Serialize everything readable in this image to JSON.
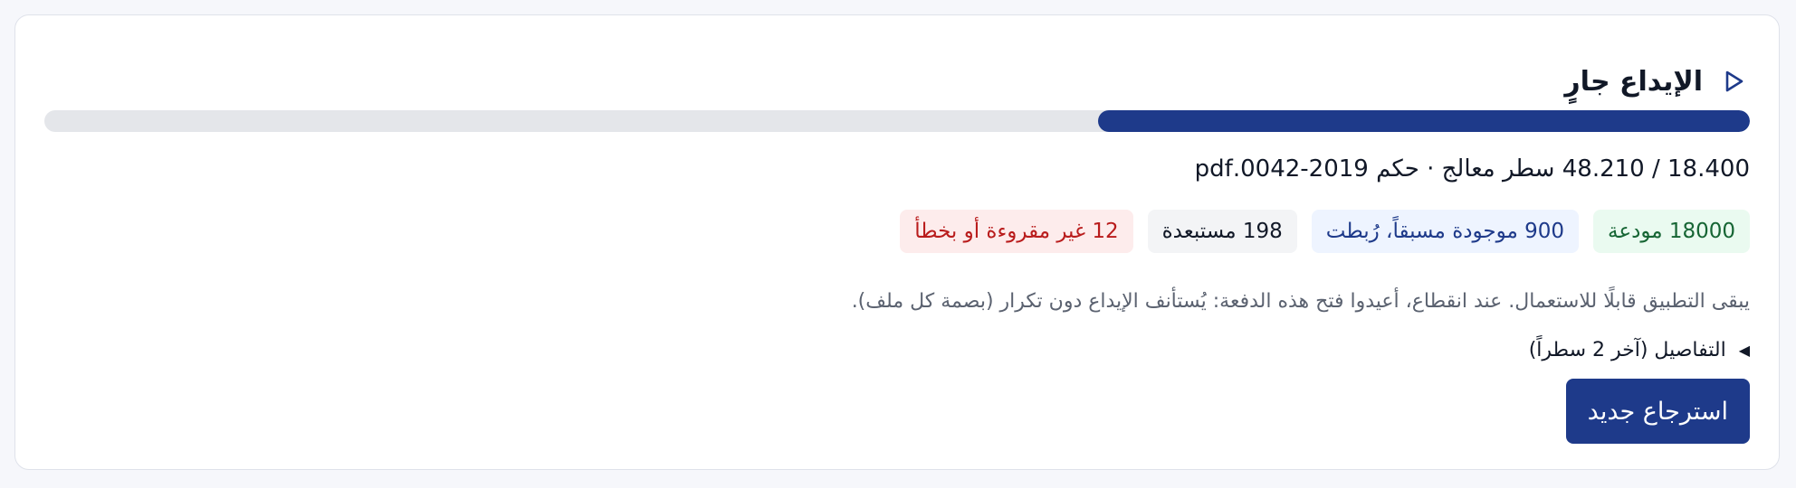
{
  "header": {
    "title": "الإيداع جارٍ",
    "icon": "play-outline-icon"
  },
  "progress": {
    "processed": 18400,
    "total": 48210,
    "fraction": 0.382
  },
  "status_line": "18.400 / 48.210 سطر معالج · حكم 2019-0042.pdf",
  "badges": [
    {
      "label": "18000 مودعة",
      "kind": "success"
    },
    {
      "label": "900 موجودة مسبقاً، رُبطت",
      "kind": "info"
    },
    {
      "label": "198 مستبعدة",
      "kind": "neutral"
    },
    {
      "label": "12 غير مقروءة أو بخطأ",
      "kind": "error"
    }
  ],
  "note": "يبقى التطبيق قابلًا للاستعمال. عند انقطاع، أعيدوا فتح هذه الدفعة: يُستأنف الإيداع دون تكرار (بصمة كل ملف).",
  "details_toggle": {
    "label": "التفاصيل (آخر 2 سطراً)",
    "icon": "triangle-left-icon",
    "expanded": false
  },
  "actions": {
    "new_import_label": "استرجاع جديد"
  },
  "colors": {
    "accent": "#1e3a8a",
    "track": "#e4e6ea",
    "success_bg": "#eafaf0",
    "success_text": "#166534",
    "info_bg": "#eef4ff",
    "info_text": "#1e3a8a",
    "neutral_bg": "#f3f4f6",
    "error_bg": "#fdecec",
    "error_text": "#b91c1c"
  }
}
